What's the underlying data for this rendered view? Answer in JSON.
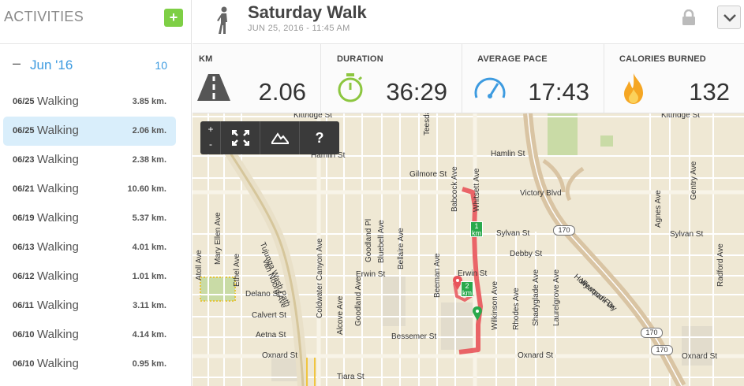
{
  "sidebar": {
    "title": "ACTIVITIES",
    "add_label": "+",
    "month": {
      "dash": "–",
      "label": "Jun '16",
      "count": "10"
    },
    "activities": [
      {
        "date": "06/25",
        "type": "Walking",
        "distance": "3.85 km."
      },
      {
        "date": "06/25",
        "type": "Walking",
        "distance": "2.06 km."
      },
      {
        "date": "06/23",
        "type": "Walking",
        "distance": "2.38 km."
      },
      {
        "date": "06/21",
        "type": "Walking",
        "distance": "10.60 km."
      },
      {
        "date": "06/19",
        "type": "Walking",
        "distance": "5.37 km."
      },
      {
        "date": "06/13",
        "type": "Walking",
        "distance": "4.01 km."
      },
      {
        "date": "06/12",
        "type": "Walking",
        "distance": "1.01 km."
      },
      {
        "date": "06/11",
        "type": "Walking",
        "distance": "3.11 km."
      },
      {
        "date": "06/10",
        "type": "Walking",
        "distance": "4.14 km."
      },
      {
        "date": "06/10",
        "type": "Walking",
        "distance": "0.95 km."
      }
    ]
  },
  "header": {
    "title": "Saturday Walk",
    "subtitle": "JUN 25, 2016  -  11:45 AM"
  },
  "stats": {
    "km": {
      "label": "KM",
      "value": "2.06"
    },
    "duration": {
      "label": "DURATION",
      "value": "36:29"
    },
    "pace": {
      "label": "AVERAGE PACE",
      "value": "17:43"
    },
    "calories": {
      "label": "CALORIES BURNED",
      "value": "132"
    }
  },
  "map": {
    "zoom_in": "+",
    "zoom_out": "-",
    "help": "?",
    "km_markers": [
      "1 km",
      "2 km"
    ],
    "highway_shields": [
      "170",
      "170",
      "170"
    ],
    "street_labels": {
      "kittridge_left": "Kittridge St",
      "kittridge_right": "Kittridge St",
      "hamlin_left": "Hamlin St",
      "hamlin_right": "Hamlin St",
      "gilmore": "Gilmore St",
      "victory": "Victory Blvd",
      "sylvan_mid": "Sylvan St",
      "sylvan_right": "Sylvan St",
      "debby": "Debby St",
      "erwin_left": "Erwin St",
      "erwin_mid": "Erwin St",
      "delano": "Delano St",
      "calvert": "Calvert St",
      "aetna": "Aetna St",
      "bessemer": "Bessemer St",
      "oxnard_left": "Oxnard St",
      "oxnard_mid": "Oxnard St",
      "oxnard_right": "Oxnard St",
      "tiara": "Tiara St",
      "hollywood": "Hollywood Fwy",
      "westpark": "Westpark Dr",
      "tujunga": "Tujunga Wash Path",
      "van_noord": "Van Noord Ave",
      "atoll": "Atoll Ave",
      "mary_ellen": "Mary Ellen Ave",
      "ethel": "Ethel Ave",
      "coldwater": "Coldwater Canyon Ave",
      "alcove": "Alcove Ave",
      "goodland_pl": "Goodland Pl",
      "goodland_ave": "Goodland Ave",
      "bluebell": "Bluebell Ave",
      "bellaire": "Bellaire Ave",
      "beeman": "Beeman Ave",
      "babcock": "Babcock Ave",
      "whitsett": "Whitsett Ave",
      "wilkinson": "Wilkinson Ave",
      "rhodes": "Rhodes Ave",
      "shadyglade": "Shadyglade Ave",
      "laurelgrove": "Laurelgrove Ave",
      "agnes": "Agnes Ave",
      "gentry": "Gentry Ave",
      "radford": "Radford Ave",
      "teesdale": "Teesdale Ave"
    }
  },
  "colors": {
    "accent_blue": "#3d9be0",
    "add_green": "#7ecf45",
    "route_red": "#e8545a",
    "marker_green": "#2aa94c",
    "selected_bg": "#d9eefb"
  },
  "icons": {
    "walker": "walking-person-icon",
    "lock": "lock-icon",
    "dropdown": "chevron-down-icon",
    "km": "road-icon",
    "duration": "stopwatch-icon",
    "pace": "speedometer-icon",
    "calories": "flame-icon"
  }
}
